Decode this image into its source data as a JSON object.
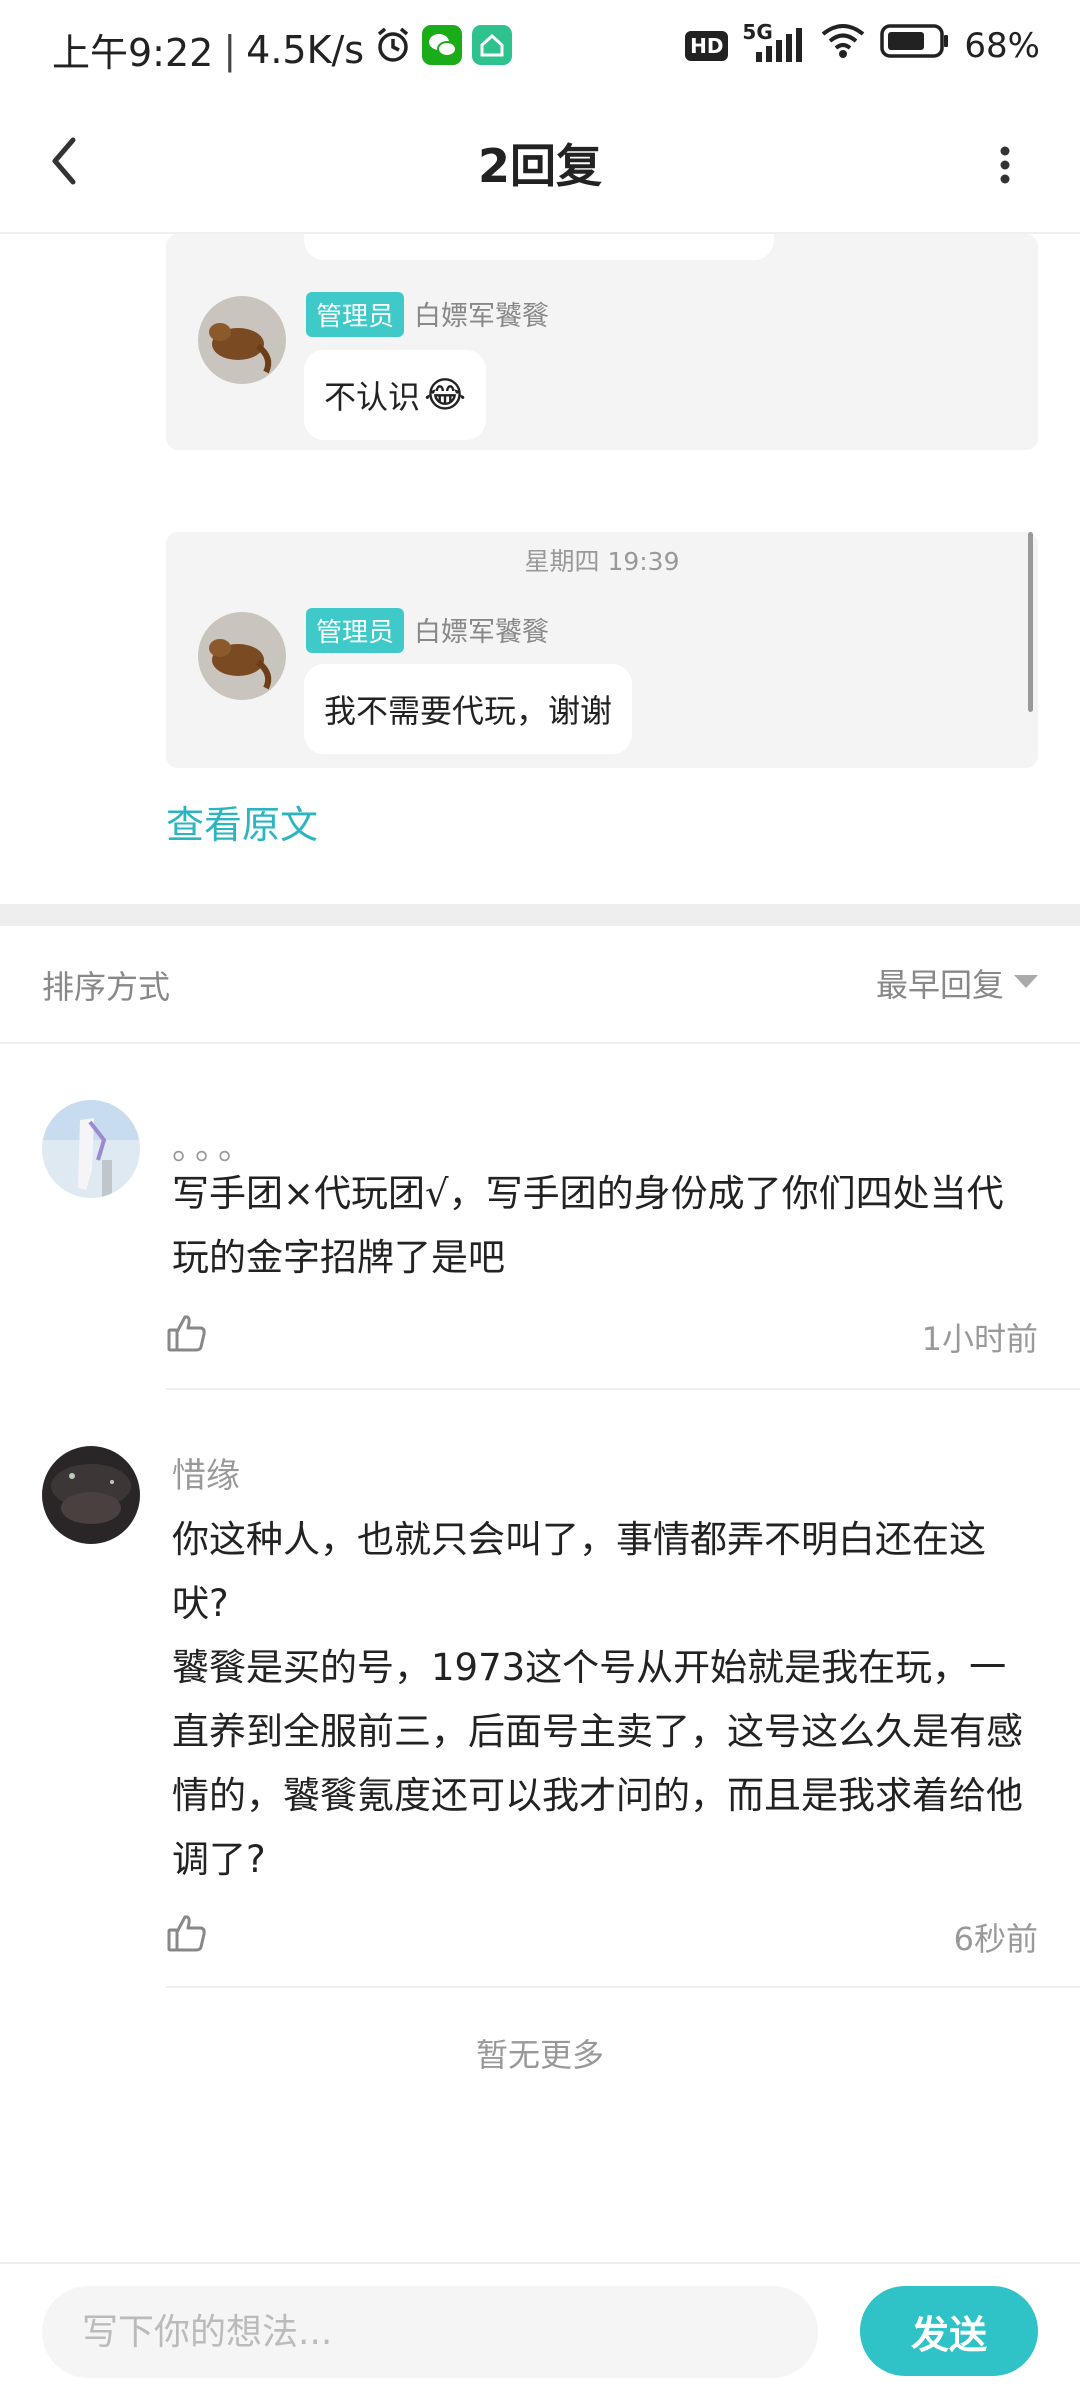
{
  "status_bar": {
    "time": "上午9:22",
    "net_speed": "4.5K/s",
    "hd": "HD",
    "network": "5G",
    "battery": "68%",
    "icons": [
      "alarm-icon",
      "wechat-icon",
      "home-app-icon",
      "signal-icon",
      "wifi-icon",
      "battery-icon"
    ]
  },
  "header": {
    "title": "2回复",
    "back_icon": "chevron-left-icon",
    "more_icon": "vertical-dots-icon"
  },
  "quoted": {
    "messages": [
      {
        "badge": "管理员",
        "user": "白嫖军饕餮",
        "text": "不认识",
        "emoji": "😂"
      },
      {
        "timestamp": "星期四 19:39",
        "badge": "管理员",
        "user": "白嫖军饕餮",
        "text": "我不需要代玩，谢谢"
      }
    ],
    "view_original": "查看原文"
  },
  "sort": {
    "label": "排序方式",
    "value": "最早回复"
  },
  "comments": [
    {
      "name": "。。。",
      "text": "写手团×代玩团√，写手团的身份成了你们四处当代玩的金字招牌了是吧",
      "time": "1小时前"
    },
    {
      "name": "惜缘",
      "text_lines": [
        "你这种人，也就只会叫了，事情都弄不明白还在这吠?",
        "饕餮是买的号，1973这个号从开始就是我在玩，一直养到全服前三，后面号主卖了，这号这么久是有感情的，饕餮氪度还可以我才问的，而且是我求着给他调了?"
      ],
      "time": "6秒前"
    }
  ],
  "no_more": "暂无更多",
  "composer": {
    "placeholder": "写下你的想法...",
    "send": "发送"
  },
  "colors": {
    "accent": "#2fc2c6",
    "badge": "#3fc9c9",
    "card_bg": "#f4f4f4"
  }
}
